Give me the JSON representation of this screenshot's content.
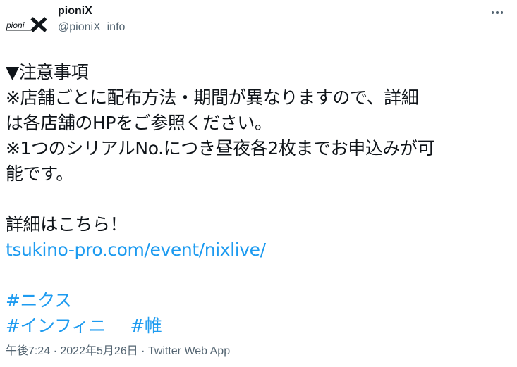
{
  "author": {
    "display_name": "pioniX",
    "handle": "@pioniX_info",
    "avatar_logo_text": "pioniX"
  },
  "menu_icon": "more-horizontal-icon",
  "tweet": {
    "lines": [
      "▼注意事項",
      "※店舗ごとに配布方法・期間が異なりますので、詳細",
      "は各店舗のHPをご参照ください。",
      "※1つのシリアルNo.につき昼夜各2枚までお申込みが可",
      "能です。",
      "",
      "詳細はこちら！"
    ],
    "link": "tsukino-pro.com/event/nixlive/",
    "hashtags": {
      "h1": "#ニクス",
      "h2": "#インフィニ",
      "h3": "#帷"
    }
  },
  "meta": {
    "time": "午後7:24",
    "separator": " · ",
    "date": "2022年5月26日",
    "source": "Twitter Web App"
  },
  "colors": {
    "text": "#0f1419",
    "secondary": "#536471",
    "link": "#1d9bf0"
  }
}
